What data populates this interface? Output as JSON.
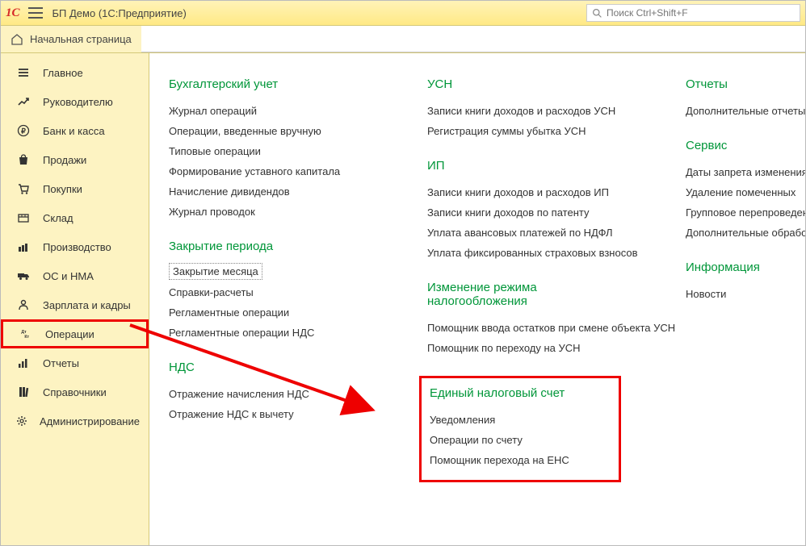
{
  "app": {
    "title": "БП Демо  (1С:Предприятие)"
  },
  "search": {
    "placeholder": "Поиск Ctrl+Shift+F"
  },
  "home_tab": {
    "label": "Начальная страница"
  },
  "sidebar": [
    {
      "label": "Главное",
      "icon": "menu"
    },
    {
      "label": "Руководителю",
      "icon": "trend"
    },
    {
      "label": "Банк и касса",
      "icon": "ruble"
    },
    {
      "label": "Продажи",
      "icon": "bag"
    },
    {
      "label": "Покупки",
      "icon": "cart"
    },
    {
      "label": "Склад",
      "icon": "box"
    },
    {
      "label": "Производство",
      "icon": "factory"
    },
    {
      "label": "ОС и НМА",
      "icon": "truck"
    },
    {
      "label": "Зарплата и кадры",
      "icon": "person"
    },
    {
      "label": "Операции",
      "icon": "dtkt",
      "selected": true
    },
    {
      "label": "Отчеты",
      "icon": "chart"
    },
    {
      "label": "Справочники",
      "icon": "books"
    },
    {
      "label": "Администрирование",
      "icon": "gear"
    }
  ],
  "col1": [
    {
      "h": "Бухгалтерский учет",
      "items": [
        "Журнал операций",
        "Операции, введенные вручную",
        "Типовые операции",
        "Формирование уставного капитала",
        "Начисление дивидендов",
        "Журнал проводок"
      ]
    },
    {
      "h": "Закрытие периода",
      "items": [
        "Закрытие месяца",
        "Справки-расчеты",
        "Регламентные операции",
        "Регламентные операции НДС"
      ],
      "first_dotted": true
    },
    {
      "h": "НДС",
      "items": [
        "Отражение начисления НДС",
        "Отражение НДС к вычету"
      ]
    }
  ],
  "col2": [
    {
      "h": "УСН",
      "items": [
        "Записи книги доходов и расходов УСН",
        "Регистрация суммы убытка УСН"
      ]
    },
    {
      "h": "ИП",
      "items": [
        "Записи книги доходов и расходов ИП",
        "Записи книги доходов по патенту",
        "Уплата авансовых платежей по НДФЛ",
        "Уплата фиксированных страховых взносов"
      ]
    },
    {
      "h": "Изменение режима налогообложения",
      "items": [
        "Помощник ввода остатков при смене объекта УСН",
        "Помощник по переходу на УСН"
      ]
    },
    {
      "h": "Единый налоговый счет",
      "items": [
        "Уведомления",
        "Операции по счету",
        "Помощник перехода на ЕНС"
      ],
      "highlight": true
    }
  ],
  "col3": [
    {
      "h": "Отчеты",
      "items": [
        "Дополнительные отчеты"
      ]
    },
    {
      "h": "Сервис",
      "items": [
        "Даты запрета изменения",
        "Удаление помеченных",
        "Групповое перепроведение",
        "Дополнительные обработки"
      ]
    },
    {
      "h": "Информация",
      "items": [
        "Новости"
      ]
    }
  ]
}
